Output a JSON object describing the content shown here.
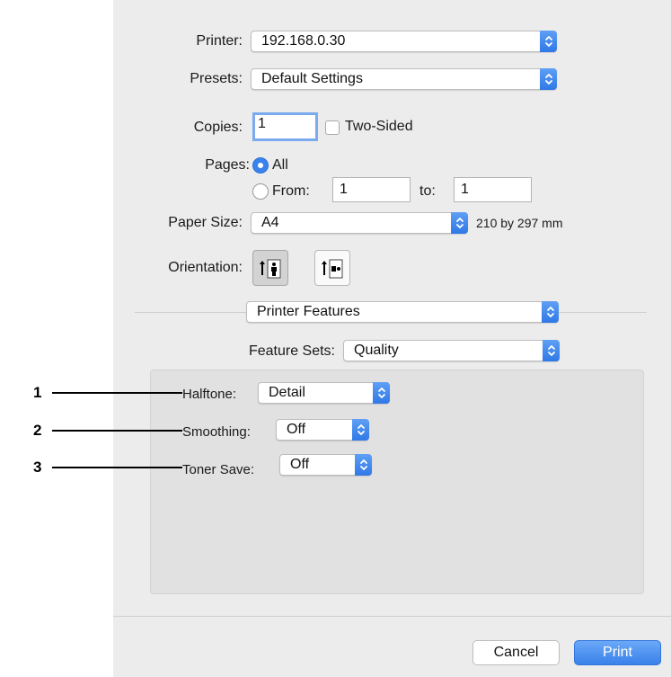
{
  "printer": {
    "label": "Printer:",
    "value": "192.168.0.30"
  },
  "presets": {
    "label": "Presets:",
    "value": "Default Settings"
  },
  "copies": {
    "label": "Copies:",
    "value": "1",
    "two_sided_label": "Two-Sided",
    "two_sided_checked": false
  },
  "pages": {
    "label": "Pages:",
    "all_label": "All",
    "from_label": "From:",
    "from_value": "1",
    "to_label": "to:",
    "to_value": "1",
    "selected": "All"
  },
  "paper_size": {
    "label": "Paper Size:",
    "value": "A4",
    "dimensions": "210 by 297 mm"
  },
  "orientation": {
    "label": "Orientation:",
    "selected": "portrait"
  },
  "section": {
    "value": "Printer Features"
  },
  "feature_sets": {
    "label": "Feature Sets:",
    "value": "Quality"
  },
  "features": {
    "halftone": {
      "label": "Halftone:",
      "value": "Detail"
    },
    "smoothing": {
      "label": "Smoothing:",
      "value": "Off"
    },
    "toner_save": {
      "label": "Toner Save:",
      "value": "Off"
    }
  },
  "callouts": [
    "1",
    "2",
    "3"
  ],
  "buttons": {
    "cancel": "Cancel",
    "print": "Print"
  },
  "colors": {
    "accent": "#3a82ea",
    "dialog_bg": "#ececec",
    "pane_bg": "#e1e1e1"
  }
}
